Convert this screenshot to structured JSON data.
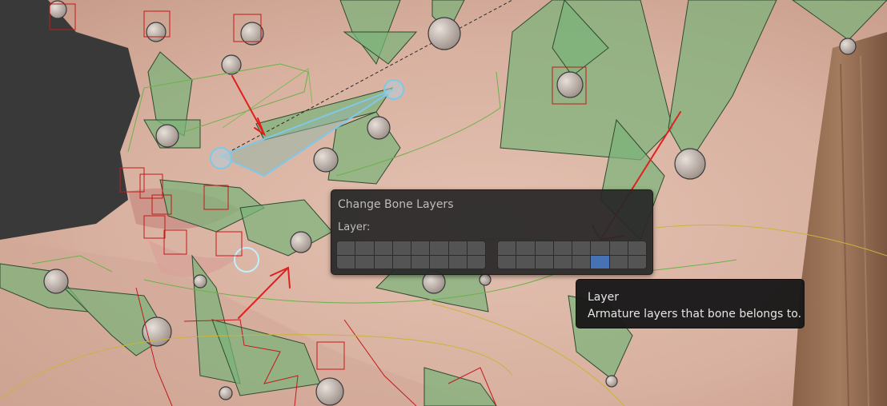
{
  "popup": {
    "title": "Change Bone Layers",
    "layer_label": "Layer:",
    "groups": [
      {
        "name": "group-1",
        "active_index": -1
      },
      {
        "name": "group-2",
        "active_index": 13
      }
    ]
  },
  "tooltip": {
    "title": "Layer",
    "description": "Armature layers that bone belongs to."
  },
  "colors": {
    "bone_fill": "#7cb37a",
    "bone_selected_outline": "#7ec8e8",
    "skin": "#dcb7a6",
    "active_layer": "#4772b3",
    "annotation_arrow": "#e02020"
  }
}
